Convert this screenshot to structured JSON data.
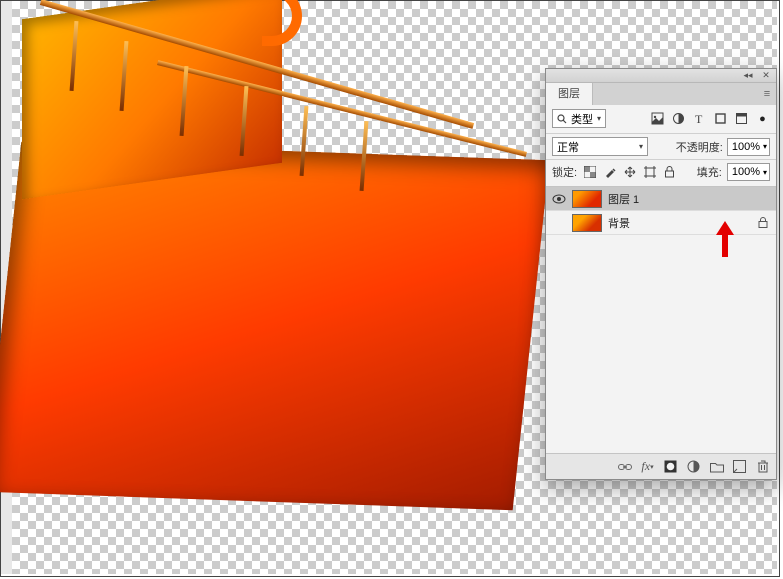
{
  "panel": {
    "tab_label": "图层",
    "filter": {
      "search_icon": "search",
      "type_label": "类型"
    },
    "blend": {
      "mode_label": "正常",
      "opacity_label": "不透明度:",
      "opacity_value": "100%"
    },
    "lock": {
      "label": "锁定:",
      "fill_label": "填充:",
      "fill_value": "100%"
    },
    "layers": [
      {
        "name": "图层 1",
        "visible": true,
        "selected": true,
        "locked": false
      },
      {
        "name": "背景",
        "visible": false,
        "selected": false,
        "locked": true
      }
    ]
  }
}
